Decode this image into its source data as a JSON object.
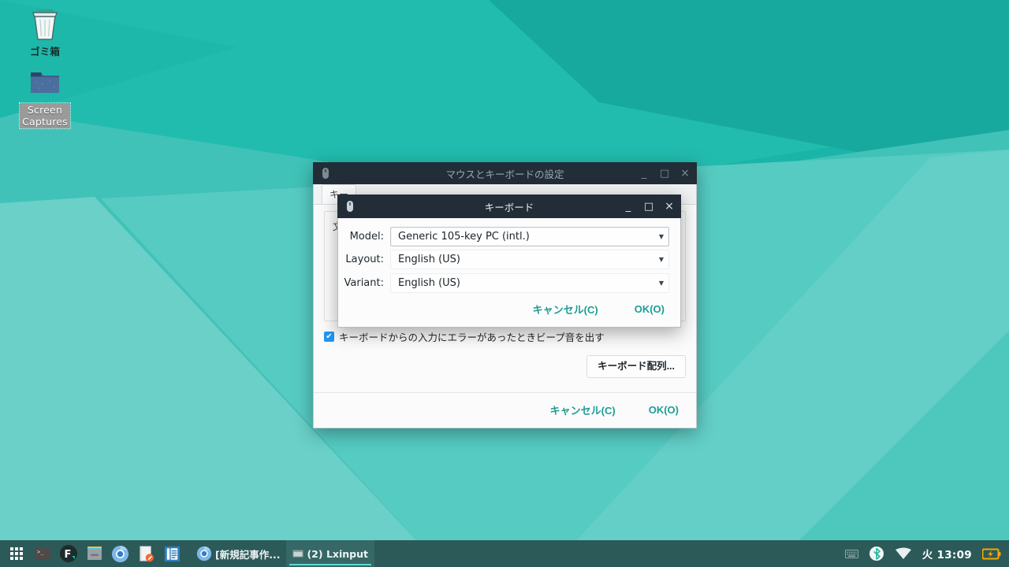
{
  "desktop": {
    "icons": [
      {
        "name": "trash",
        "label": "ゴミ箱",
        "icon": "trash-icon"
      },
      {
        "name": "screen-captures",
        "label": "Screen\nCaptures",
        "label_line1": "Screen",
        "label_line2": "Captures",
        "icon": "folder-icon"
      }
    ],
    "wallpaper_colors": {
      "base": "#1ab5a8",
      "light": "#5cc9c1",
      "lighter": "#74d2cb",
      "mid": "#41c2b8",
      "dark": "#16a89c"
    }
  },
  "parent_window": {
    "title": "マウスとキーボードの設定",
    "icon": "mouse-icon",
    "titlebar_buttons": {
      "minimize": "_",
      "maximize": "□",
      "close": "×"
    },
    "tab_label": "キー",
    "group_text": "文",
    "beep_checkbox": {
      "label": "キーボードからの入力にエラーがあったときビープ音を出す",
      "checked": true,
      "mark": "✔"
    },
    "keyboard_layout_button": "キーボード配列...",
    "actions": {
      "cancel": "キャンセル(C)",
      "ok": "OK(O)"
    },
    "accent_color": "#1b9e93"
  },
  "keyboard_dialog": {
    "title": "キーボード",
    "icon": "mouse-icon",
    "titlebar_buttons": {
      "minimize": "_",
      "maximize": "□",
      "close": "×"
    },
    "fields": [
      {
        "name": "model",
        "label": "Model:",
        "value": "Generic 105-key PC (intl.)",
        "focused": true
      },
      {
        "name": "layout",
        "label": "Layout:",
        "value": "English (US)",
        "focused": false
      },
      {
        "name": "variant",
        "label": "Variant:",
        "value": "English (US)",
        "focused": false
      }
    ],
    "caret": "▼",
    "actions": {
      "cancel": "キャンセル(C)",
      "ok": "OK(O)"
    }
  },
  "taskbar": {
    "launchers": [
      {
        "name": "app-menu",
        "icon": "grid-menu-icon"
      },
      {
        "name": "terminal",
        "icon": "terminal-icon"
      },
      {
        "name": "fcitx",
        "icon": "fcitx-icon",
        "letter": "F"
      },
      {
        "name": "file-manager",
        "icon": "file-cabinet-icon"
      },
      {
        "name": "chromium",
        "icon": "chromium-icon"
      },
      {
        "name": "text-editor",
        "icon": "notepad-edit-icon"
      },
      {
        "name": "document-viewer",
        "icon": "document-list-icon"
      }
    ],
    "windows": [
      {
        "name": "chromium-window",
        "icon": "chromium-icon",
        "label": "[新規記事作...",
        "active": false
      },
      {
        "name": "lxinput-window",
        "icon": "window-icon",
        "label": "(2) Lxinput",
        "active": true
      }
    ],
    "tray": [
      {
        "name": "keyboard-indicator",
        "icon": "keyboard-icon"
      },
      {
        "name": "bluetooth",
        "icon": "bluetooth-icon"
      },
      {
        "name": "wifi",
        "icon": "wifi-icon"
      }
    ],
    "clock": "火 13:09",
    "battery": {
      "name": "battery",
      "icon": "battery-charging-icon",
      "color": "#f6a800"
    }
  }
}
